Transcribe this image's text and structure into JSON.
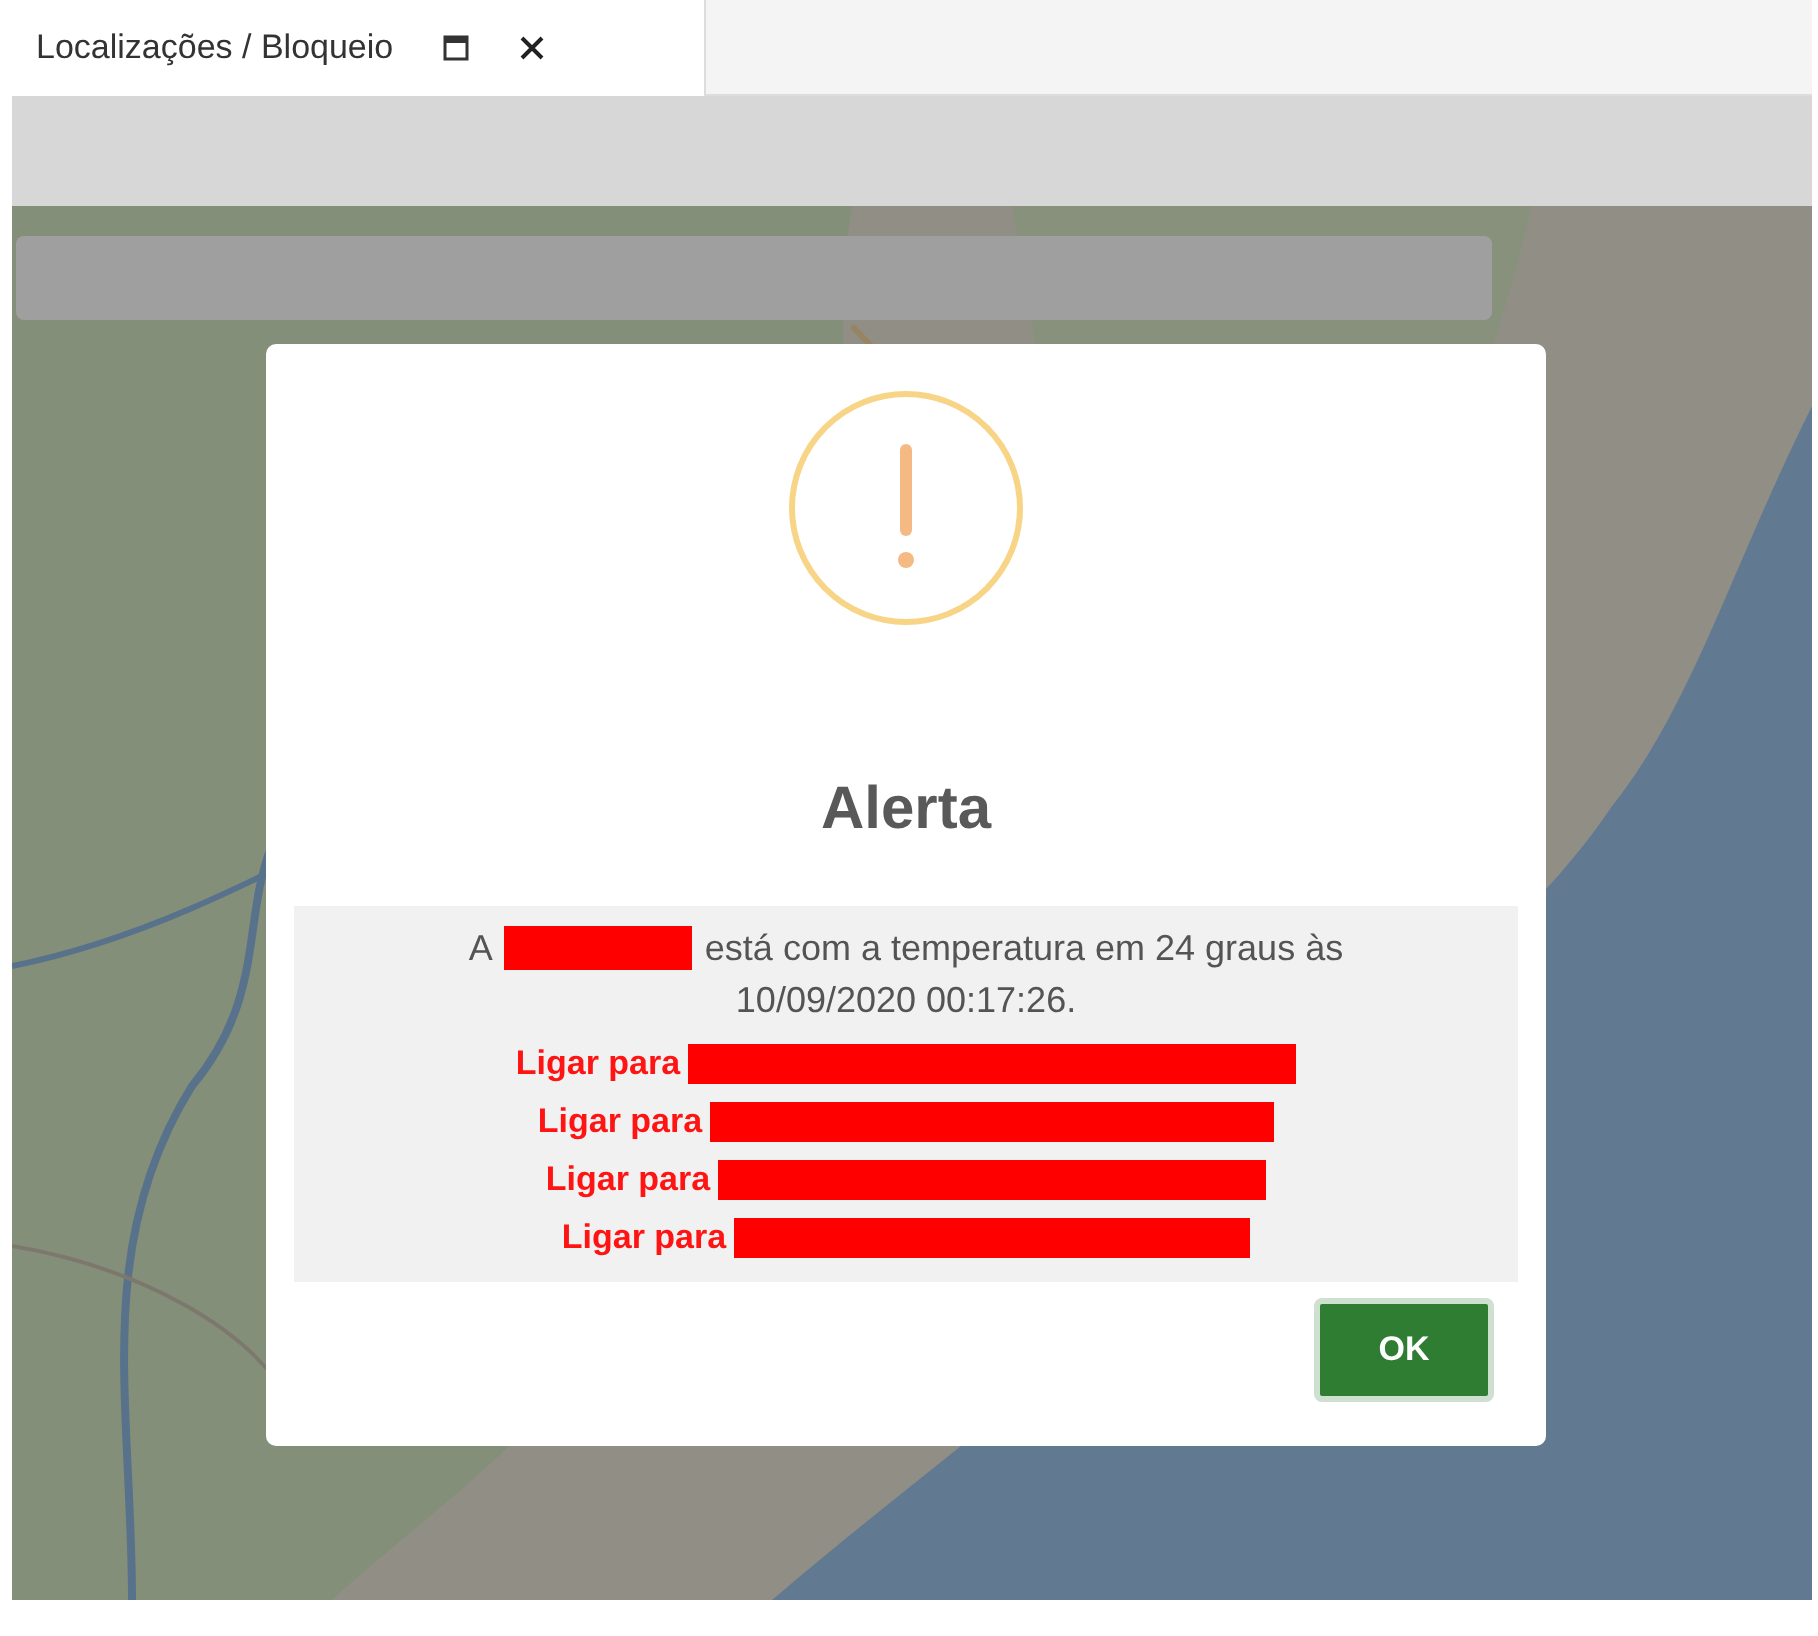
{
  "tab": {
    "title": "Localizações / Bloqueio"
  },
  "alert": {
    "title": "Alerta",
    "message": {
      "prefix": "A",
      "redacted": true,
      "text": "está com a temperatura em 24 graus às",
      "timestamp": "10/09/2020 00:17:26."
    },
    "contacts": [
      {
        "label": "Ligar para",
        "redacted": true
      },
      {
        "label": "Ligar para",
        "redacted": true
      },
      {
        "label": "Ligar para",
        "redacted": true
      },
      {
        "label": "Ligar para",
        "redacted": true
      }
    ],
    "button": "OK"
  }
}
